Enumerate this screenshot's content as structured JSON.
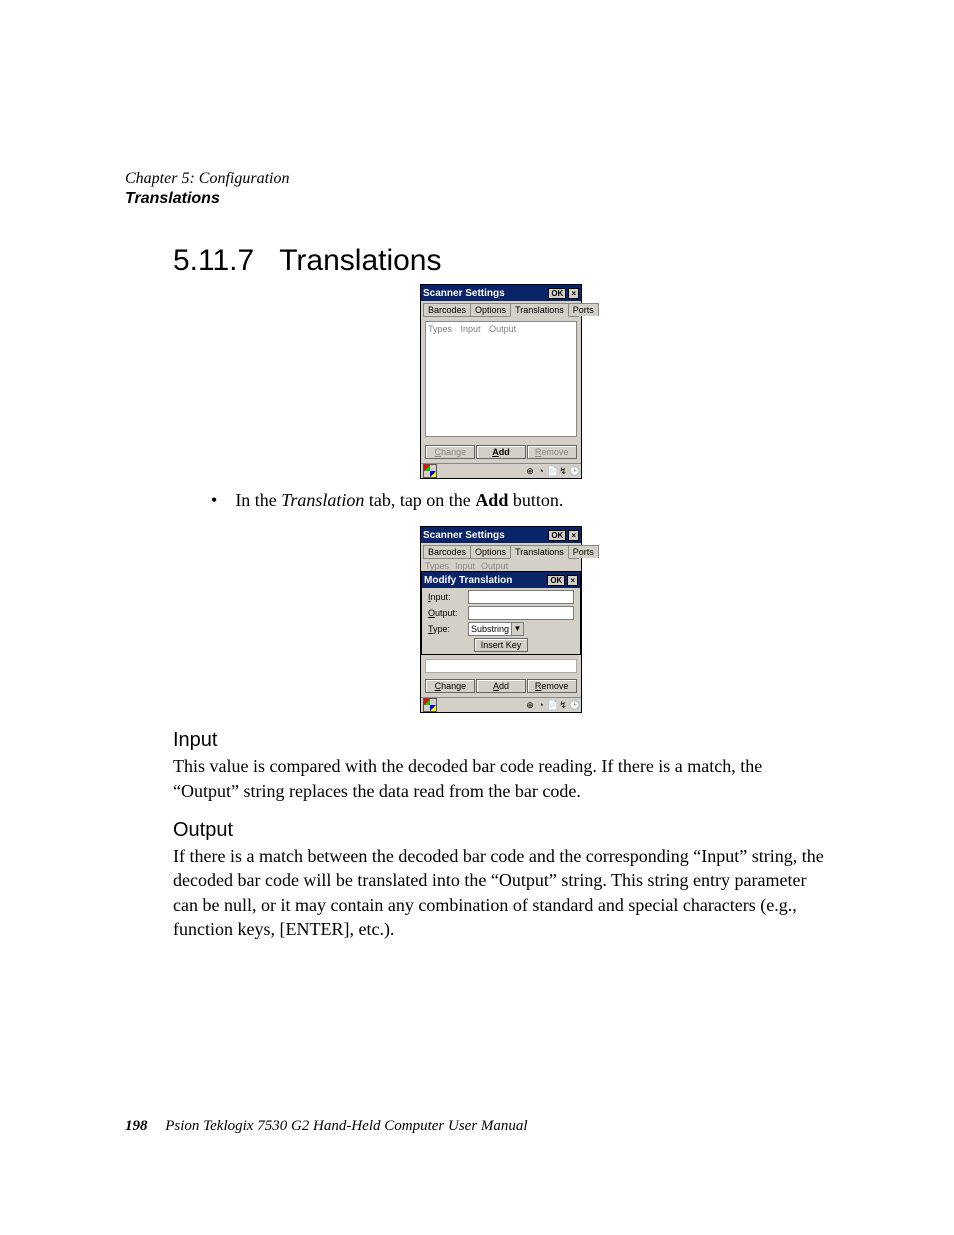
{
  "header": {
    "chapter": "Chapter 5: Configuration",
    "section": "Translations"
  },
  "title": {
    "number": "5.11.7",
    "text": "Translations"
  },
  "dialog1": {
    "title": "Scanner Settings",
    "ok": "OK",
    "close": "×",
    "tabs": {
      "barcodes": "Barcodes",
      "options": "Options",
      "translations": "Translations",
      "ports": "Ports"
    },
    "columns": {
      "types": "Types",
      "input": "Input",
      "output": "Output"
    },
    "buttons": {
      "change": "Change",
      "add": "Add",
      "remove": "Remove"
    }
  },
  "bullet": {
    "pre": "In the ",
    "italic": "Translation",
    "mid": " tab, tap on the ",
    "bold": "Add",
    "post": " button."
  },
  "dialog2": {
    "title": "Scanner Settings",
    "ok": "OK",
    "close": "×",
    "tabs": {
      "barcodes": "Barcodes",
      "options": "Options",
      "translations": "Translations",
      "ports": "Ports"
    },
    "subcols": {
      "types": "Types",
      "input": "Input",
      "output": "Output"
    },
    "modify_title": "Modify Translation",
    "modify_ok": "OK",
    "modify_close": "×",
    "labels": {
      "input": "Input:",
      "output": "Output:",
      "type": "Type:"
    },
    "type_value": "Substring",
    "insert_key": "Insert Key",
    "buttons": {
      "change": "Change",
      "add": "Add",
      "remove": "Remove"
    }
  },
  "sections": {
    "input_h": "Input",
    "input_p": "This value is compared with the decoded bar code reading. If there is a match, the “Output” string replaces the data read from the bar code.",
    "output_h": "Output",
    "output_p": "If there is a match between the decoded bar code and the corresponding “Input” string, the decoded bar code will be translated into the “Output” string. This string entry parameter can be null, or it may contain any combination of standard and special characters (e.g., function keys, [ENTER], etc.)."
  },
  "footer": {
    "page": "198",
    "text": "Psion Teklogix 7530 G2 Hand-Held Computer User Manual"
  }
}
